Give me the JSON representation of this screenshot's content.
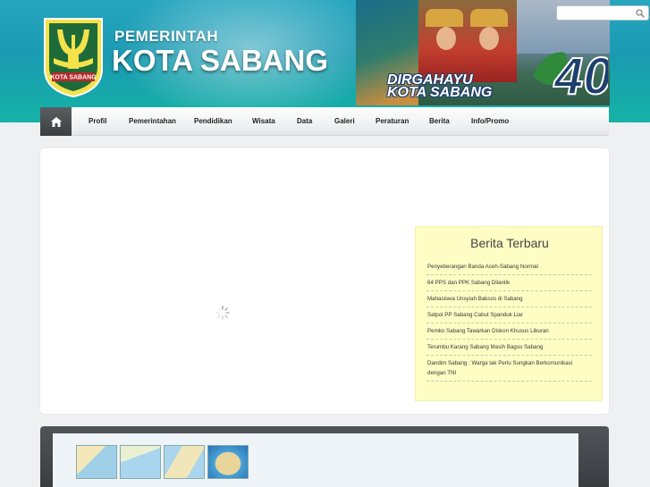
{
  "header": {
    "title_small": "PEMERINTAH",
    "title_big": "KOTA SABANG",
    "logo_text": "KOTA SABANG",
    "banner_line1": "DIRGAHAYU",
    "banner_line2": "KOTA SABANG",
    "banner_number": "40"
  },
  "search": {
    "placeholder": "",
    "icon": "search-icon"
  },
  "nav": {
    "home_icon": "home-icon",
    "items": [
      "Profil",
      "Pemerintahan",
      "Pendidikan",
      "Wisata",
      "Data",
      "Galeri",
      "Peraturan",
      "Berita",
      "Info/Promo"
    ]
  },
  "berita": {
    "title": "Berita Terbaru",
    "items": [
      "Penyeberangan Banda Aceh-Sabang Normal",
      "64 PPS dan PPK Sabang Dilantik",
      "Mahasiswa Unsyiah Baksos di Sabang",
      "Satpol PP Sabang Cabut Spanduk Liar",
      "Pemko Sabang Tawarkan Diskon Khusus Liburan",
      "Terumbu Karang Sabang Masih Bagus Sabang",
      "Dandim Sabang : Warga tak Perlu Sungkan Berkomunikasi dengan TNI"
    ]
  },
  "colors": {
    "header_teal": "#1a9ab2",
    "nav_home_bg": "#3c3f42",
    "berita_bg": "#fdfdc4",
    "footer_bg": "#3a3d40"
  }
}
